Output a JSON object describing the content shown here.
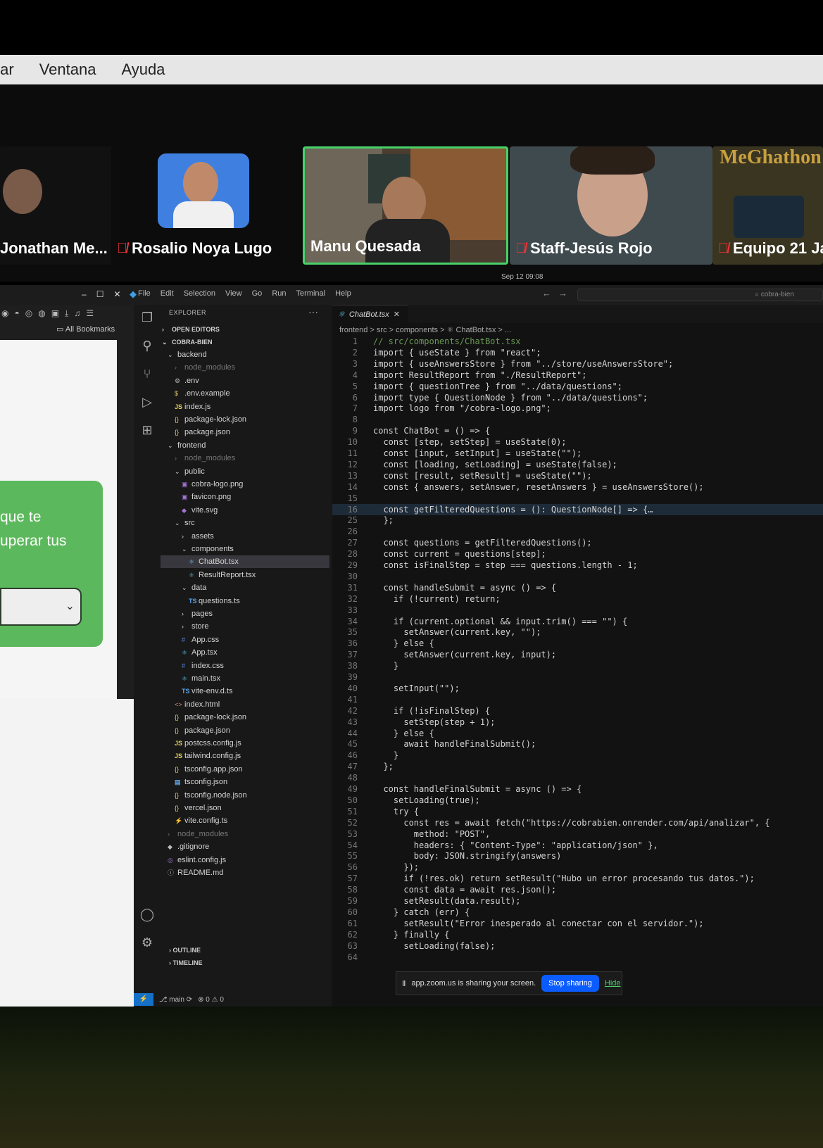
{
  "mac_menu": [
    "tar",
    "Ventana",
    "Ayuda"
  ],
  "zoom": {
    "participants": [
      {
        "name": "Jonathan Me...",
        "muted": false
      },
      {
        "name": "Rosalio Noya Lugo",
        "muted": true
      },
      {
        "name": "Manu Quesada",
        "muted": false,
        "active": true
      },
      {
        "name": "Staff-Jesús Rojo",
        "muted": true
      },
      {
        "name": "Equipo 21 Ja",
        "muted": true
      }
    ],
    "poster_text": "MeGhathon",
    "date": "Sep 12 09:08"
  },
  "vscode": {
    "window_controls": [
      "–",
      "☐",
      "✕"
    ],
    "menu": [
      "File",
      "Edit",
      "Selection",
      "View",
      "Go",
      "Run",
      "Terminal",
      "Help"
    ],
    "search_placeholder": "⌕ cobra-bien",
    "browser": {
      "bookmarks": "All Bookmarks",
      "card_line1": "que te",
      "card_line2": "uperar tus"
    },
    "explorer": {
      "title": "EXPLORER",
      "open_editors": "OPEN EDITORS",
      "project": "COBRA-BIEN",
      "files": [
        {
          "label": "backend",
          "type": "folder-open"
        },
        {
          "label": "node_modules",
          "type": "folder",
          "dim": true
        },
        {
          "label": ".env",
          "type": "gear"
        },
        {
          "label": ".env.example",
          "type": "dollar"
        },
        {
          "label": "index.js",
          "type": "js"
        },
        {
          "label": "package-lock.json",
          "type": "json"
        },
        {
          "label": "package.json",
          "type": "json"
        },
        {
          "label": "frontend",
          "type": "folder-open"
        },
        {
          "label": "node_modules",
          "type": "folder",
          "dim": true
        },
        {
          "label": "public",
          "type": "folder-open"
        },
        {
          "label": "cobra-logo.png",
          "type": "img"
        },
        {
          "label": "favicon.png",
          "type": "img"
        },
        {
          "label": "vite.svg",
          "type": "svg"
        },
        {
          "label": "src",
          "type": "folder-open"
        },
        {
          "label": "assets",
          "type": "folder"
        },
        {
          "label": "components",
          "type": "folder-open"
        },
        {
          "label": "ChatBot.tsx",
          "type": "react",
          "selected": true
        },
        {
          "label": "ResultReport.tsx",
          "type": "react"
        },
        {
          "label": "data",
          "type": "folder-open"
        },
        {
          "label": "questions.ts",
          "type": "ts"
        },
        {
          "label": "pages",
          "type": "folder"
        },
        {
          "label": "store",
          "type": "folder"
        },
        {
          "label": "App.css",
          "type": "css"
        },
        {
          "label": "App.tsx",
          "type": "react"
        },
        {
          "label": "index.css",
          "type": "css"
        },
        {
          "label": "main.tsx",
          "type": "react"
        },
        {
          "label": "vite-env.d.ts",
          "type": "ts"
        },
        {
          "label": "index.html",
          "type": "html"
        },
        {
          "label": "package-lock.json",
          "type": "json"
        },
        {
          "label": "package.json",
          "type": "json"
        },
        {
          "label": "postcss.config.js",
          "type": "js"
        },
        {
          "label": "tailwind.config.js",
          "type": "js"
        },
        {
          "label": "tsconfig.app.json",
          "type": "json"
        },
        {
          "label": "tsconfig.json",
          "type": "tsconfig"
        },
        {
          "label": "tsconfig.node.json",
          "type": "json"
        },
        {
          "label": "vercel.json",
          "type": "json"
        },
        {
          "label": "vite.config.ts",
          "type": "vite"
        },
        {
          "label": "node_modules",
          "type": "folder",
          "dim": true
        },
        {
          "label": ".gitignore",
          "type": "git"
        },
        {
          "label": "eslint.config.js",
          "type": "eslint"
        },
        {
          "label": "README.md",
          "type": "info"
        }
      ],
      "outline": "OUTLINE",
      "timeline": "TIMELINE"
    },
    "tab": "ChatBot.tsx",
    "breadcrumb": "frontend > src > components > ⚛ ChatBot.tsx > ...",
    "code": [
      {
        "n": "1",
        "t": "// src/components/ChatBot.tsx"
      },
      {
        "n": "2",
        "t": "import { useState } from \"react\";"
      },
      {
        "n": "3",
        "t": "import { useAnswersStore } from \"../store/useAnswersStore\";"
      },
      {
        "n": "4",
        "t": "import ResultReport from \"./ResultReport\";"
      },
      {
        "n": "5",
        "t": "import { questionTree } from \"../data/questions\";"
      },
      {
        "n": "6",
        "t": "import type { QuestionNode } from \"../data/questions\";"
      },
      {
        "n": "7",
        "t": "import logo from \"/cobra-logo.png\";"
      },
      {
        "n": "8",
        "t": ""
      },
      {
        "n": "9",
        "t": "const ChatBot = () => {"
      },
      {
        "n": "10",
        "t": "  const [step, setStep] = useState(0);"
      },
      {
        "n": "11",
        "t": "  const [input, setInput] = useState(\"\");"
      },
      {
        "n": "12",
        "t": "  const [loading, setLoading] = useState(false);"
      },
      {
        "n": "13",
        "t": "  const [result, setResult] = useState(\"\");"
      },
      {
        "n": "14",
        "t": "  const { answers, setAnswer, resetAnswers } = useAnswersStore();"
      },
      {
        "n": "15",
        "t": ""
      },
      {
        "n": "16",
        "t": "  const getFilteredQuestions = (): QuestionNode[] => {…"
      },
      {
        "n": "25",
        "t": "  };"
      },
      {
        "n": "26",
        "t": ""
      },
      {
        "n": "27",
        "t": "  const questions = getFilteredQuestions();"
      },
      {
        "n": "28",
        "t": "  const current = questions[step];"
      },
      {
        "n": "29",
        "t": "  const isFinalStep = step === questions.length - 1;"
      },
      {
        "n": "30",
        "t": ""
      },
      {
        "n": "31",
        "t": "  const handleSubmit = async () => {"
      },
      {
        "n": "32",
        "t": "    if (!current) return;"
      },
      {
        "n": "33",
        "t": ""
      },
      {
        "n": "34",
        "t": "    if (current.optional && input.trim() === \"\") {"
      },
      {
        "n": "35",
        "t": "      setAnswer(current.key, \"\");"
      },
      {
        "n": "36",
        "t": "    } else {"
      },
      {
        "n": "37",
        "t": "      setAnswer(current.key, input);"
      },
      {
        "n": "38",
        "t": "    }"
      },
      {
        "n": "39",
        "t": ""
      },
      {
        "n": "40",
        "t": "    setInput(\"\");"
      },
      {
        "n": "41",
        "t": ""
      },
      {
        "n": "42",
        "t": "    if (!isFinalStep) {"
      },
      {
        "n": "43",
        "t": "      setStep(step + 1);"
      },
      {
        "n": "44",
        "t": "    } else {"
      },
      {
        "n": "45",
        "t": "      await handleFinalSubmit();"
      },
      {
        "n": "46",
        "t": "    }"
      },
      {
        "n": "47",
        "t": "  };"
      },
      {
        "n": "48",
        "t": ""
      },
      {
        "n": "49",
        "t": "  const handleFinalSubmit = async () => {"
      },
      {
        "n": "50",
        "t": "    setLoading(true);"
      },
      {
        "n": "51",
        "t": "    try {"
      },
      {
        "n": "52",
        "t": "      const res = await fetch(\"https://cobrabien.onrender.com/api/analizar\", {"
      },
      {
        "n": "53",
        "t": "        method: \"POST\","
      },
      {
        "n": "54",
        "t": "        headers: { \"Content-Type\": \"application/json\" },"
      },
      {
        "n": "55",
        "t": "        body: JSON.stringify(answers)"
      },
      {
        "n": "56",
        "t": "      });"
      },
      {
        "n": "57",
        "t": "      if (!res.ok) return setResult(\"Hubo un error procesando tus datos.\");"
      },
      {
        "n": "58",
        "t": "      const data = await res.json();"
      },
      {
        "n": "59",
        "t": "      setResult(data.result);"
      },
      {
        "n": "60",
        "t": "    } catch (err) {"
      },
      {
        "n": "61",
        "t": "      setResult(\"Error inesperado al conectar con el servidor.\");"
      },
      {
        "n": "62",
        "t": "    } finally {"
      },
      {
        "n": "63",
        "t": "      setLoading(false);"
      },
      {
        "n": "64",
        "t": ""
      }
    ],
    "share": {
      "text": "app.zoom.us is sharing your screen.",
      "stop": "Stop sharing",
      "hide": "Hide"
    },
    "status": {
      "branch": "⎇ main ⟳",
      "problems": "⊗ 0 ⚠ 0"
    }
  },
  "colors": {
    "zoom_active": "#47d26a",
    "card_green": "#5cb85c",
    "stop_blue": "#0b5cff"
  }
}
